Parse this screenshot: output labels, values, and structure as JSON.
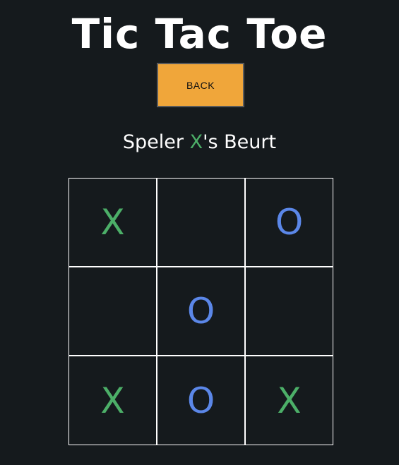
{
  "title": "Tic Tac Toe",
  "back_button": {
    "label": "BACK"
  },
  "status": {
    "prefix": "Speler ",
    "player": "X",
    "suffix": "'s Beurt"
  },
  "colors": {
    "background": "#151a1d",
    "back_button": "#f0a63a",
    "x_mark": "#4caf68",
    "o_mark": "#5b87e8",
    "grid_lines": "#ffffff"
  },
  "board": {
    "cells": [
      "X",
      "",
      "O",
      "",
      "O",
      "",
      "X",
      "O",
      "X"
    ]
  }
}
